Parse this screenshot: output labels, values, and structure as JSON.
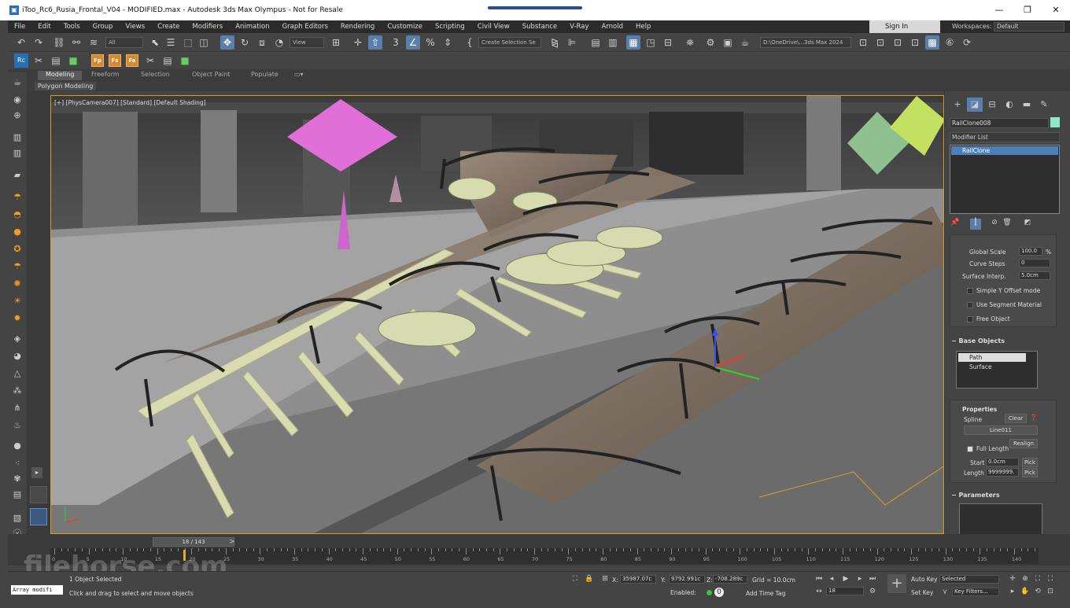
{
  "window": {
    "title": "iToo_Rc6_Rusia_Frontal_V04 - MODIFIED.max - Autodesk 3ds Max Olympus - Not for Resale",
    "min": "—",
    "max": "❐",
    "close": "✕"
  },
  "menus": [
    "File",
    "Edit",
    "Tools",
    "Group",
    "Views",
    "Create",
    "Modifiers",
    "Animation",
    "Graph Editors",
    "Rendering",
    "Customize",
    "Scripting",
    "Civil View",
    "Substance",
    "V-Ray",
    "Arnold",
    "Help"
  ],
  "signin": "Sign In",
  "workspaces": {
    "label": "Workspaces:",
    "value": "Default"
  },
  "toolbar": {
    "filter": "All",
    "view": "View",
    "selection_set": "Create Selection Se",
    "path": "D:\\OneDrive\\...3ds Max 2024"
  },
  "toolbar2_orange": [
    "Fp",
    "Fs",
    "Fa"
  ],
  "ribbon": {
    "tabs": [
      "Modeling",
      "Freeform",
      "Selection",
      "Object Paint",
      "Populate"
    ],
    "sub": "Polygon Modeling"
  },
  "viewport": {
    "label": "[+] [PhysCamera007] [Standard] [Default Shading]"
  },
  "command_panel": {
    "object_name": "RailClone008",
    "modifier_list": "Modifier List",
    "stack_item": "RailClone",
    "geometry": {
      "global_scale_label": "Global Scale",
      "global_scale": "100.0",
      "global_scale_unit": "%",
      "curve_steps_label": "Curve Steps",
      "curve_steps": "0",
      "surface_interp_label": "Surface Interp.",
      "surface_interp": "5.0cm",
      "simple_y": "Simple Y Offset mode",
      "use_segment": "Use Segment Material",
      "free_object": "Free Object"
    },
    "base_objects": {
      "header": "Base Objects",
      "items": [
        "Path",
        "Surface"
      ]
    },
    "properties": {
      "header": "Properties",
      "spline_label": "Spline",
      "clear": "Clear",
      "spline_value": "Line011",
      "full_length": "Full Length",
      "realign": "Realign",
      "start_label": "Start",
      "start": "0.0cm",
      "pick": "Pick",
      "length_label": "Length",
      "length": "9999999."
    },
    "parameters": {
      "header": "Parameters"
    }
  },
  "timeline": {
    "slider": "18 / 143",
    "ticks": [
      0,
      5,
      10,
      15,
      20,
      25,
      30,
      35,
      40,
      45,
      50,
      55,
      60,
      65,
      70,
      75,
      80,
      85,
      90,
      95,
      100,
      105,
      110,
      115,
      120,
      125,
      130,
      135,
      140
    ]
  },
  "status": {
    "script": "Array modifi",
    "selected": "1 Object Selected",
    "hint": "Click and drag to select and move objects",
    "x_label": "X:",
    "x": "35987.07c",
    "y_label": "Y:",
    "y": "9792.991c",
    "z_label": "Z:",
    "z": "-708.289c",
    "grid": "Grid = 10.0cm",
    "enabled": "Enabled:",
    "add_time_tag": "Add Time Tag",
    "frame": "18",
    "auto_key": "Auto Key",
    "set_key": "Set Key",
    "selected_dd": "Selected",
    "key_filters": "Key Filters..."
  },
  "watermark": "filehorse.com",
  "colors": {
    "accent": "#5b7fa8",
    "viewport_border": "#d8a020",
    "orange": "#d88a2a"
  }
}
